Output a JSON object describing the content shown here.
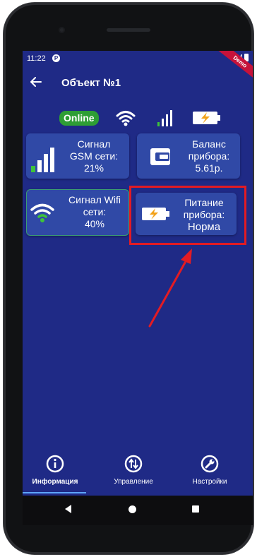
{
  "status_bar": {
    "time": "11:22",
    "app_icon": "P",
    "network": "4",
    "demo_label": "Demo"
  },
  "app_bar": {
    "title": "Объект №1",
    "back_icon": "arrow-left-icon"
  },
  "connection": {
    "online_label": "Online"
  },
  "cards": {
    "gsm": {
      "line1": "Сигнал",
      "line2": "GSM сети:",
      "value": "21%",
      "icon": "signal-bars-icon",
      "icon_color": "#3ec43a"
    },
    "balance": {
      "line1": "Баланс",
      "line2": "прибора:",
      "value": "5.61р.",
      "icon": "wallet-icon"
    },
    "wifi": {
      "line1": "Сигнал Wifi",
      "line2": "сети:",
      "value": "40%",
      "icon": "wifi-icon",
      "icon_color": "#3ec43a"
    },
    "power": {
      "line1": "Питание",
      "line2": "прибора:",
      "value": "Норма",
      "icon": "battery-charging-icon",
      "icon_color": "#f2a21a"
    }
  },
  "bottom_nav": {
    "items": [
      {
        "label": "Информация",
        "icon": "info-icon",
        "active": true
      },
      {
        "label": "Управление",
        "icon": "control-arrows-icon",
        "active": false
      },
      {
        "label": "Настройки",
        "icon": "wrench-icon",
        "active": false
      }
    ]
  },
  "colors": {
    "background": "#1f2a86",
    "card": "#3049a6",
    "online": "#2e9e35",
    "highlight": "#e31b23"
  }
}
